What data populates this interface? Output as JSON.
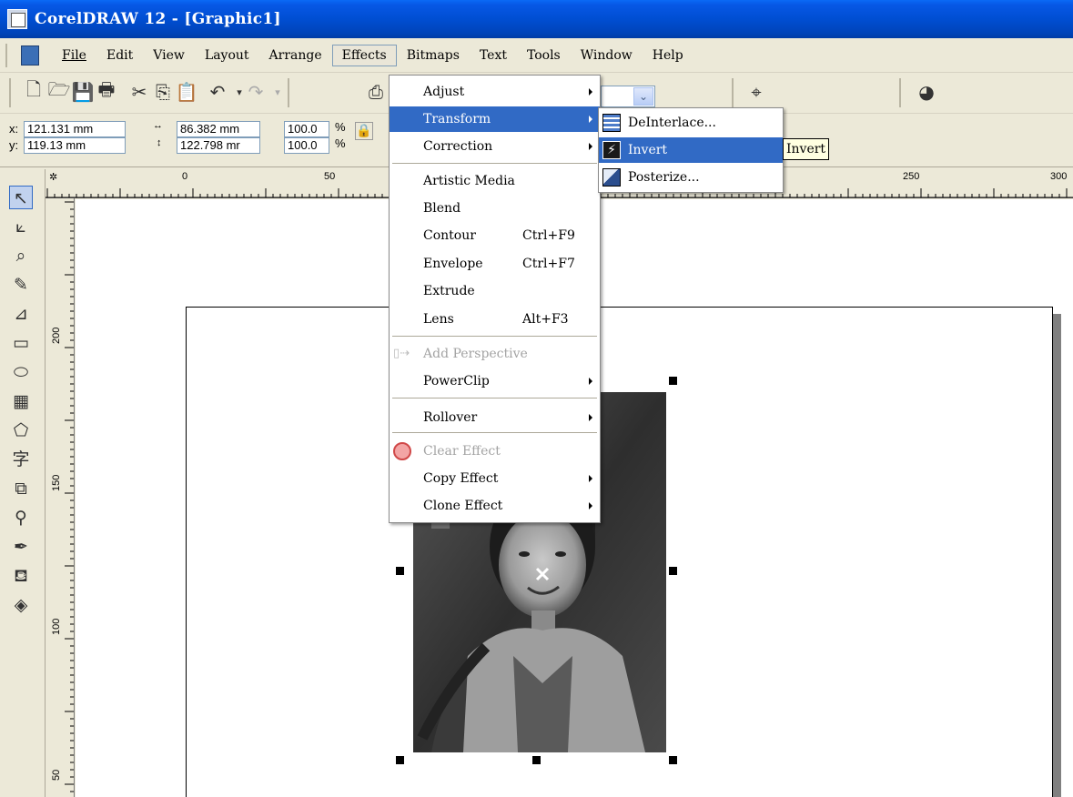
{
  "window": {
    "title": "CorelDRAW 12 - [Graphic1]"
  },
  "menubar": {
    "items": [
      {
        "id": "file",
        "label": "File"
      },
      {
        "id": "edit",
        "label": "Edit"
      },
      {
        "id": "view",
        "label": "View"
      },
      {
        "id": "layout",
        "label": "Layout"
      },
      {
        "id": "arrange",
        "label": "Arrange"
      },
      {
        "id": "effects",
        "label": "Effects"
      },
      {
        "id": "bitmaps",
        "label": "Bitmaps"
      },
      {
        "id": "text",
        "label": "Text"
      },
      {
        "id": "tools",
        "label": "Tools"
      },
      {
        "id": "window",
        "label": "Window"
      },
      {
        "id": "help",
        "label": "Help"
      }
    ],
    "open_menu": "Effects"
  },
  "property_bar": {
    "x_label": "x:",
    "x_value": "121.131 mm",
    "y_label": "y:",
    "y_value": "119.13 mm",
    "width_value": "86.382 mm",
    "height_value": "122.798 mr",
    "scale_x": "100.0",
    "scale_y": "100.0",
    "percent": "%"
  },
  "ruler": {
    "top_ticks": [
      "0",
      "50",
      "250",
      "300"
    ],
    "left_ticks": [
      "200",
      "150",
      "100",
      "50"
    ]
  },
  "effects_menu": {
    "items": [
      {
        "label": "Adjust",
        "submenu": true
      },
      {
        "label": "Transform",
        "submenu": true,
        "highlighted": true
      },
      {
        "label": "Correction",
        "submenu": true
      },
      {
        "label": "Artistic Media"
      },
      {
        "label": "Blend"
      },
      {
        "label": "Contour",
        "shortcut": "Ctrl+F9"
      },
      {
        "label": "Envelope",
        "shortcut": "Ctrl+F7"
      },
      {
        "label": "Extrude"
      },
      {
        "label": "Lens",
        "shortcut": "Alt+F3"
      },
      {
        "label": "Add Perspective",
        "disabled": true
      },
      {
        "label": "PowerClip",
        "submenu": true
      },
      {
        "label": "Rollover",
        "submenu": true
      },
      {
        "label": "Clear Effect",
        "disabled": true
      },
      {
        "label": "Copy Effect",
        "submenu": true
      },
      {
        "label": "Clone Effect",
        "submenu": true
      }
    ]
  },
  "transform_submenu": {
    "items": [
      {
        "label": "DeInterlace..."
      },
      {
        "label": "Invert",
        "highlighted": true
      },
      {
        "label": "Posterize..."
      }
    ]
  },
  "tooltip": {
    "text": "Invert"
  },
  "colors": {
    "highlight": "#316ac5",
    "title_bar": "#0054e3",
    "chrome": "#ece9d8"
  }
}
